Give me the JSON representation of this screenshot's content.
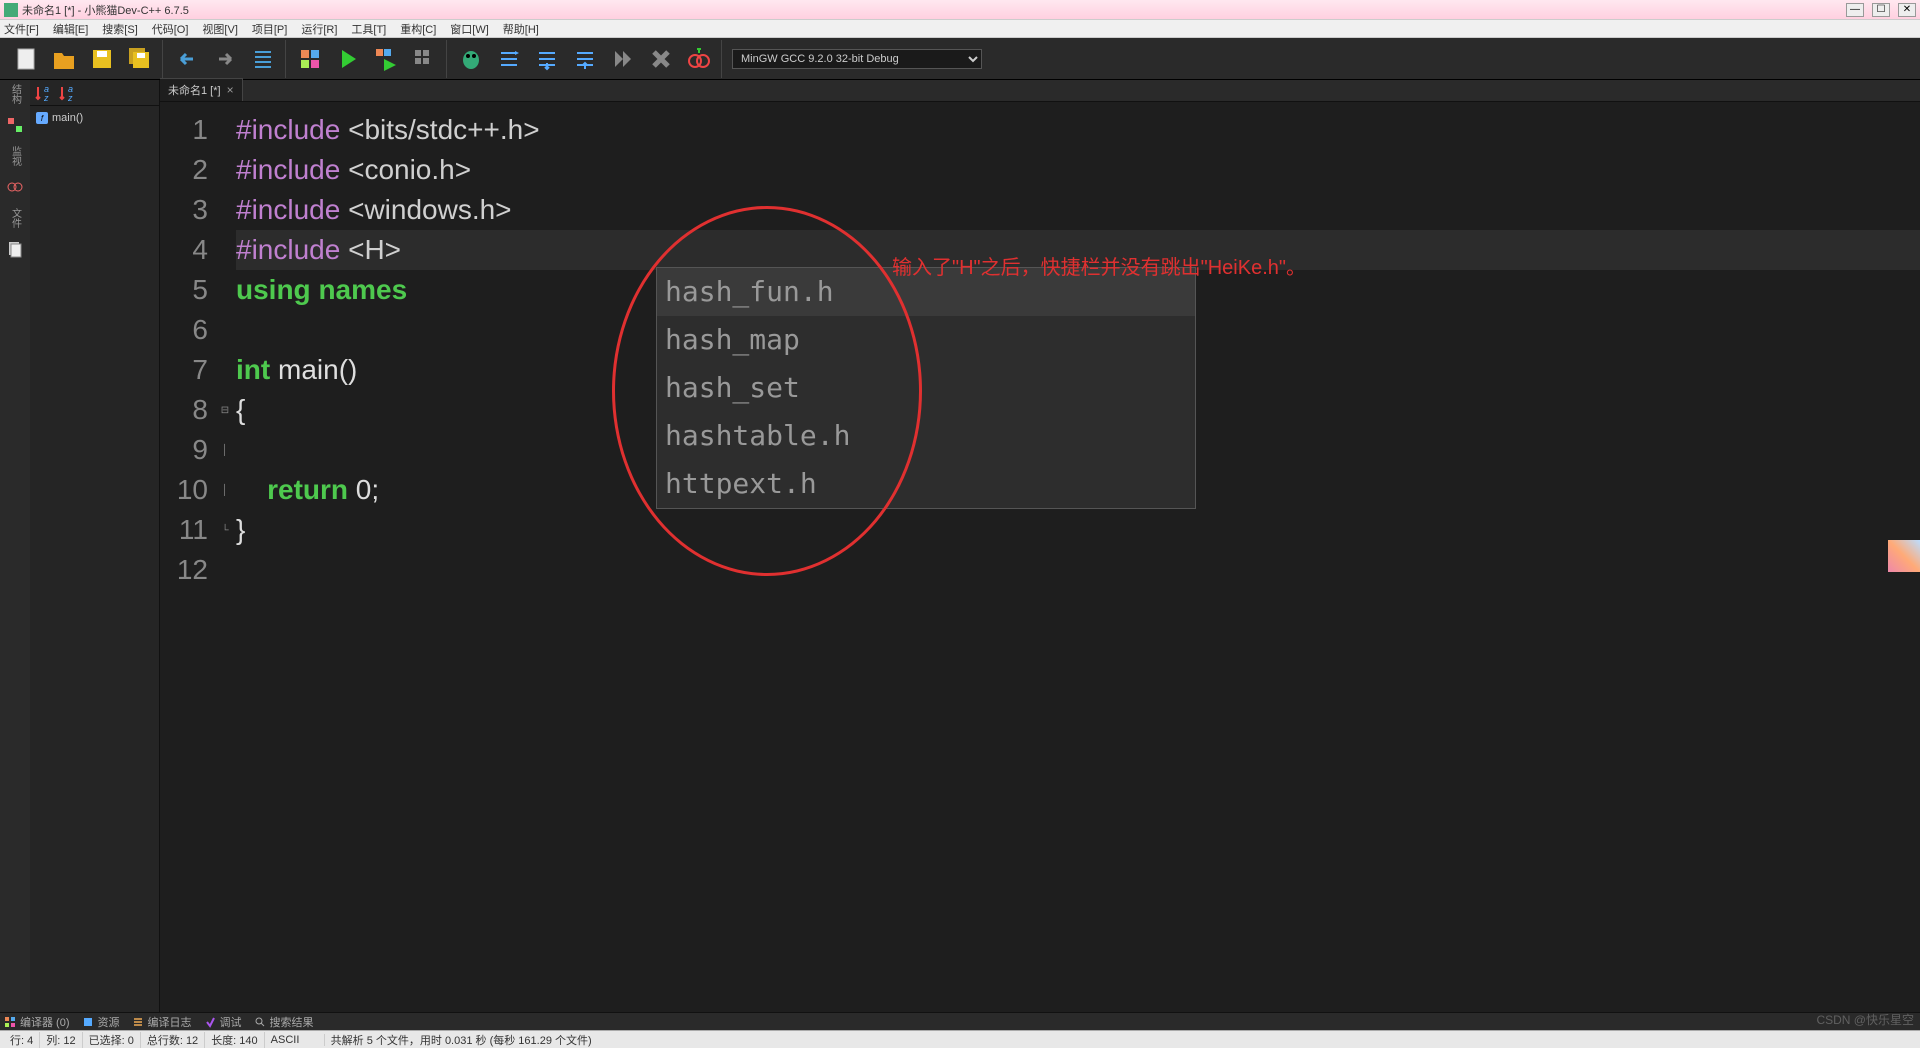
{
  "window": {
    "title": "未命名1 [*] - 小熊猫Dev-C++ 6.7.5",
    "min": "—",
    "max": "☐",
    "close": "✕"
  },
  "menu": {
    "items": [
      "文件[F]",
      "编辑[E]",
      "搜索[S]",
      "代码[O]",
      "视图[V]",
      "项目[P]",
      "运行[R]",
      "工具[T]",
      "重构[C]",
      "窗口[W]",
      "帮助[H]"
    ]
  },
  "compiler": {
    "selected": "MinGW GCC 9.2.0 32-bit Debug"
  },
  "sidebar": {
    "labels": [
      "结构",
      "监视",
      "文件"
    ]
  },
  "struct_panel": {
    "tree_item": "main()"
  },
  "tab": {
    "label": "未命名1 [*]"
  },
  "code": {
    "lines": [
      {
        "n": "1",
        "pre": "#include ",
        "rest": "<bits/stdc++.h>"
      },
      {
        "n": "2",
        "pre": "#include ",
        "rest": "<conio.h>"
      },
      {
        "n": "3",
        "pre": "#include ",
        "rest": "<windows.h>"
      },
      {
        "n": "4",
        "pre": "#include ",
        "rest": "<H>"
      },
      {
        "n": "5",
        "g1": "using",
        "g2": " names",
        "rest": ""
      },
      {
        "n": "6",
        "rest": ""
      },
      {
        "n": "7",
        "g1": "int",
        "fn": " main",
        "rest": "()"
      },
      {
        "n": "8",
        "rest": "{"
      },
      {
        "n": "9",
        "rest": ""
      },
      {
        "n": "10",
        "g1": "    return",
        "rest": " 0;"
      },
      {
        "n": "11",
        "rest": "}"
      },
      {
        "n": "12",
        "rest": ""
      }
    ]
  },
  "autocomplete": {
    "items": [
      "hash_fun.h",
      "hash_map",
      "hash_set",
      "hashtable.h",
      "httpext.h"
    ]
  },
  "annotation": {
    "text": "输入了\"H\"之后，快捷栏并没有跳出\"HeiKe.h\"。"
  },
  "bottom_tabs": {
    "items": [
      "编译器 (0)",
      "资源",
      "编译日志",
      "调试",
      "搜索结果"
    ]
  },
  "status": {
    "row": "行:  4",
    "col": "列:  12",
    "sel": "已选择:  0",
    "total": "总行数:  12",
    "len": "长度:  140",
    "enc": "ASCII",
    "parse": "共解析 5 个文件，用时 0.031 秒 (每秒 161.29 个文件)"
  },
  "watermark": "CSDN @快乐星空"
}
